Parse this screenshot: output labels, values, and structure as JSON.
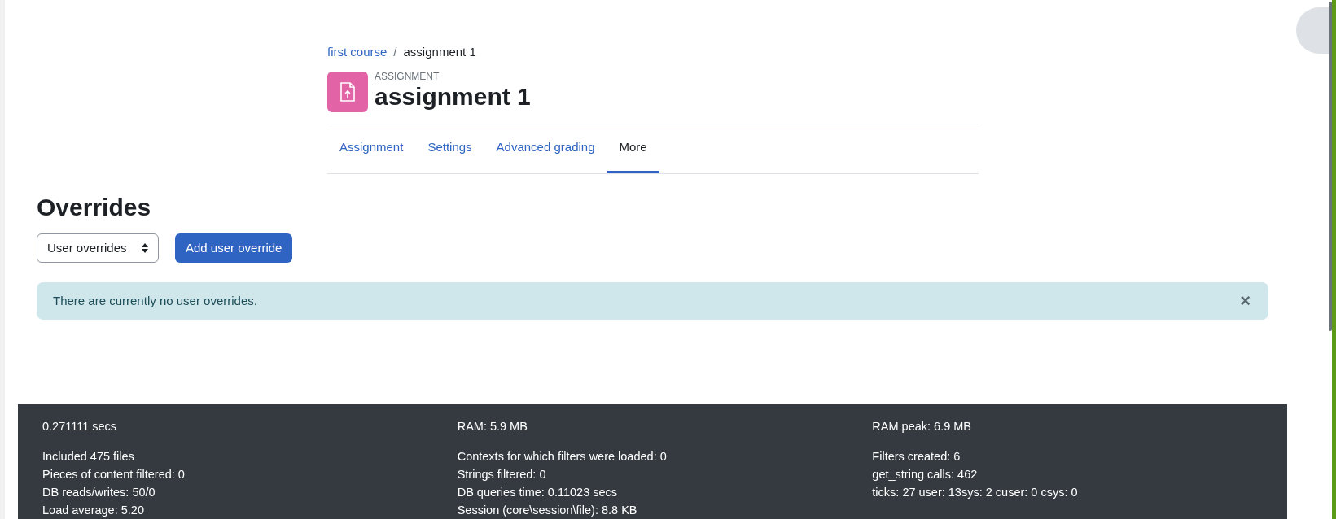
{
  "breadcrumb": [
    {
      "label": "first course",
      "link": true
    },
    {
      "label": "assignment 1",
      "link": false
    }
  ],
  "breadcrumb_separator": "/",
  "header": {
    "kind_label": "ASSIGNMENT",
    "title": "assignment 1"
  },
  "tabs": [
    {
      "label": "Assignment",
      "selected": false
    },
    {
      "label": "Settings",
      "selected": false
    },
    {
      "label": "Advanced grading",
      "selected": false
    },
    {
      "label": "More",
      "selected": true
    }
  ],
  "heading": "Overrides",
  "select": {
    "value": "User overrides"
  },
  "add_button": "Add user override",
  "alert": {
    "message": "There are currently no user overrides.",
    "close": "×"
  },
  "footer": {
    "columns": [
      {
        "top": "0.271111 secs",
        "lines": [
          "Included 475 files",
          "Pieces of content filtered: 0",
          "DB reads/writes: 50/0",
          "Load average: 5.20"
        ]
      },
      {
        "top": "RAM: 5.9 MB",
        "lines": [
          "Contexts for which filters were loaded: 0",
          "Strings filtered: 0",
          "DB queries time: 0.11023 secs",
          "Session (core\\session\\file): 8.8 KB"
        ]
      },
      {
        "top": "RAM peak: 6.9 MB",
        "lines": [
          "Filters created: 6",
          "get_string calls: 462",
          "ticks: 27 user: 13sys: 2 cuser: 0 csys: 0"
        ]
      }
    ]
  }
}
